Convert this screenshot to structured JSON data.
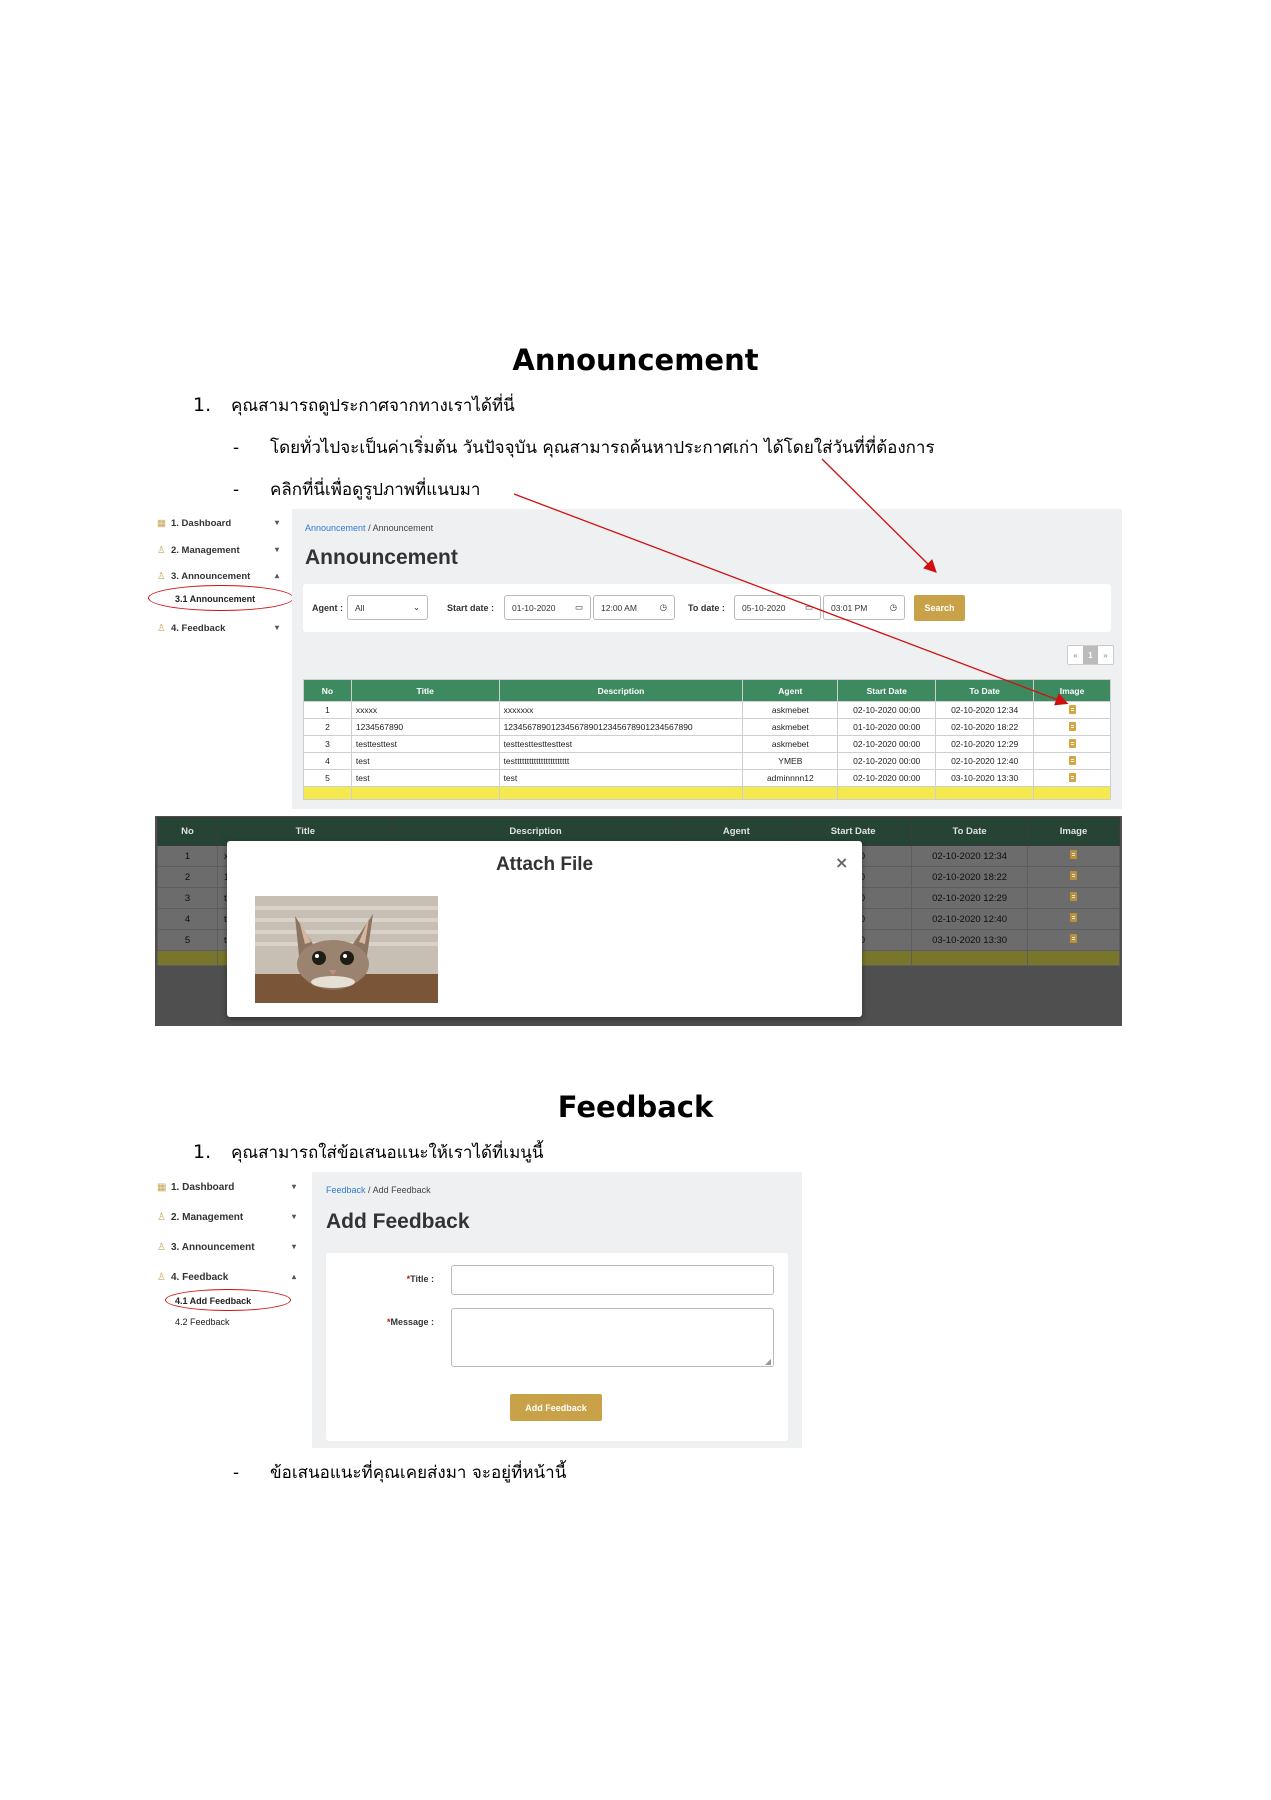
{
  "announcement_section": {
    "heading": "Announcement",
    "item1_num": "1.",
    "item1_text": "คุณสามารถดูประกาศจากทางเราได้ที่นี่",
    "bullet_dash": "-",
    "bullet1": "โดยทั่วไปจะเป็นค่าเริ่มต้น วันปัจจุบัน คุณสามารถค้นหาประกาศเก่า ได้โดยใส่วันที่ที่ต้องการ",
    "bullet2": "คลิกที่นี่เพื่อดูรูปภาพที่แนบมา"
  },
  "sidebar1": {
    "items": [
      {
        "label": "1. Dashboard",
        "chevron": "▾"
      },
      {
        "label": "2. Management",
        "chevron": "▾"
      },
      {
        "label": "3. Announcement",
        "chevron": "▴"
      },
      {
        "label": "4. Feedback",
        "chevron": "▾"
      }
    ],
    "sub_active": "3.1 Announcement"
  },
  "announcement_page": {
    "breadcrumb_link": "Announcement",
    "breadcrumb_sep": "/",
    "breadcrumb_current": "Announcement",
    "title": "Announcement",
    "agent_label": "Agent :",
    "agent_value": "All",
    "start_label": "Start date :",
    "start_date": "01-10-2020",
    "start_time": "12:00 AM",
    "to_label": "To date :",
    "to_date": "05-10-2020",
    "to_time": "03:01 PM",
    "search_label": "Search",
    "pager": {
      "prev": "«",
      "page": "1",
      "next": "»"
    },
    "columns": [
      "No",
      "Title",
      "Description",
      "Agent",
      "Start Date",
      "To Date",
      "Image"
    ],
    "rows": [
      {
        "no": "1",
        "title": "xxxxx",
        "desc": "xxxxxxx",
        "agent": "askmebet",
        "start": "02-10-2020 00:00",
        "to": "02-10-2020 12:34"
      },
      {
        "no": "2",
        "title": "1234567890",
        "desc": "1234567890123456789012345678901234567890",
        "agent": "askmebet",
        "start": "01-10-2020 00:00",
        "to": "02-10-2020 18:22"
      },
      {
        "no": "3",
        "title": "testtesttest",
        "desc": "testtesttesttesttest",
        "agent": "askmebet",
        "start": "02-10-2020 00:00",
        "to": "02-10-2020 12:29"
      },
      {
        "no": "4",
        "title": "test",
        "desc": "testtttttttttttttttttttttt",
        "agent": "YMEB",
        "start": "02-10-2020 00:00",
        "to": "02-10-2020 12:40"
      },
      {
        "no": "5",
        "title": "test",
        "desc": "test",
        "agent": "adminnnn12",
        "start": "02-10-2020 00:00",
        "to": "03-10-2020 13:30"
      }
    ]
  },
  "modal_screenshot": {
    "columns": [
      "No",
      "Title",
      "Description",
      "Agent",
      "Start Date",
      "To Date",
      "Image"
    ],
    "rows": [
      {
        "no": "1",
        "title": "x",
        "start": "00:00",
        "to": "02-10-2020 12:34"
      },
      {
        "no": "2",
        "title": "1.",
        "start": "00:00",
        "to": "02-10-2020 18:22"
      },
      {
        "no": "3",
        "title": "te",
        "start": "00:00",
        "to": "02-10-2020 12:29"
      },
      {
        "no": "4",
        "title": "te",
        "start": "00:00",
        "to": "02-10-2020 12:40"
      },
      {
        "no": "5",
        "title": "te",
        "start": "00:00",
        "to": "03-10-2020 13:30"
      }
    ],
    "modal_title": "Attach File",
    "close": "×"
  },
  "feedback_section": {
    "heading": "Feedback",
    "item1_num": "1.",
    "item1_text": "คุณสามารถใส่ข้อเสนอแนะให้เราได้ที่เมนูนี้",
    "bullet_dash": "-",
    "bullet1": "ข้อเสนอแนะที่คุณเคยส่งมา จะอยู่ที่หน้านี้"
  },
  "sidebar3": {
    "items": [
      {
        "label": "1. Dashboard",
        "chevron": "▾"
      },
      {
        "label": "2. Management",
        "chevron": "▾"
      },
      {
        "label": "3. Announcement",
        "chevron": "▾"
      },
      {
        "label": "4. Feedback",
        "chevron": "▴"
      }
    ],
    "sub_active": "4.1 Add Feedback",
    "sub_other": "4.2 Feedback"
  },
  "feedback_page": {
    "breadcrumb_link": "Feedback",
    "breadcrumb_sep": "/",
    "breadcrumb_current": "Add Feedback",
    "title": "Add Feedback",
    "req_mark": "*",
    "title_label": "Title :",
    "message_label": "Message :",
    "submit_label": "Add Feedback"
  },
  "colors": {
    "table_header": "#3d8a60",
    "button_gold": "#c9a148",
    "highlight_row": "#f4e94d",
    "annotation_red": "#d01010",
    "link_blue": "#2f7bd5"
  }
}
